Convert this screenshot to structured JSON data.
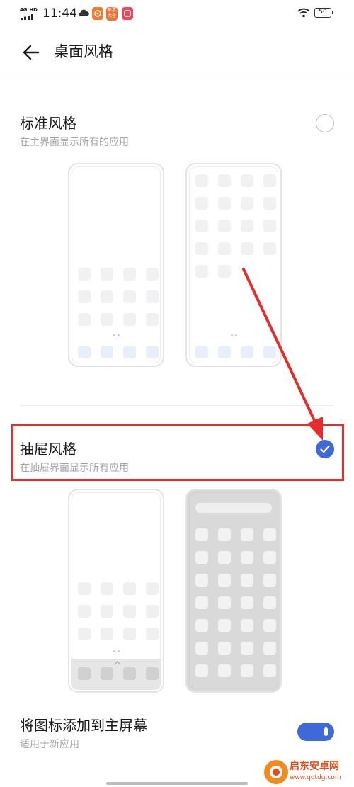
{
  "status_bar": {
    "network": "4G⁺HD",
    "time": "11:44",
    "app_badges": [
      "",
      "彩票大全",
      ""
    ],
    "battery": "50",
    "icons": [
      "signal-icon",
      "cloud-icon",
      "wifi-icon",
      "battery-icon"
    ]
  },
  "header": {
    "title": "桌面风格",
    "back_icon": "arrow-left-icon"
  },
  "options": [
    {
      "title": "标准风格",
      "subtitle": "在主界面显示所有的应用",
      "selected": false
    },
    {
      "title": "抽屉风格",
      "subtitle": "在抽屉界面显示所有应用",
      "selected": true
    }
  ],
  "add_to_home": {
    "title": "将图标添加到主屏幕",
    "subtitle": "适用于新应用",
    "enabled": true
  },
  "colors": {
    "accent": "#4069d8",
    "annotation_red": "#e42d2d"
  },
  "watermark": {
    "title": "启东安卓网",
    "url": "www.qdtdg.com"
  }
}
